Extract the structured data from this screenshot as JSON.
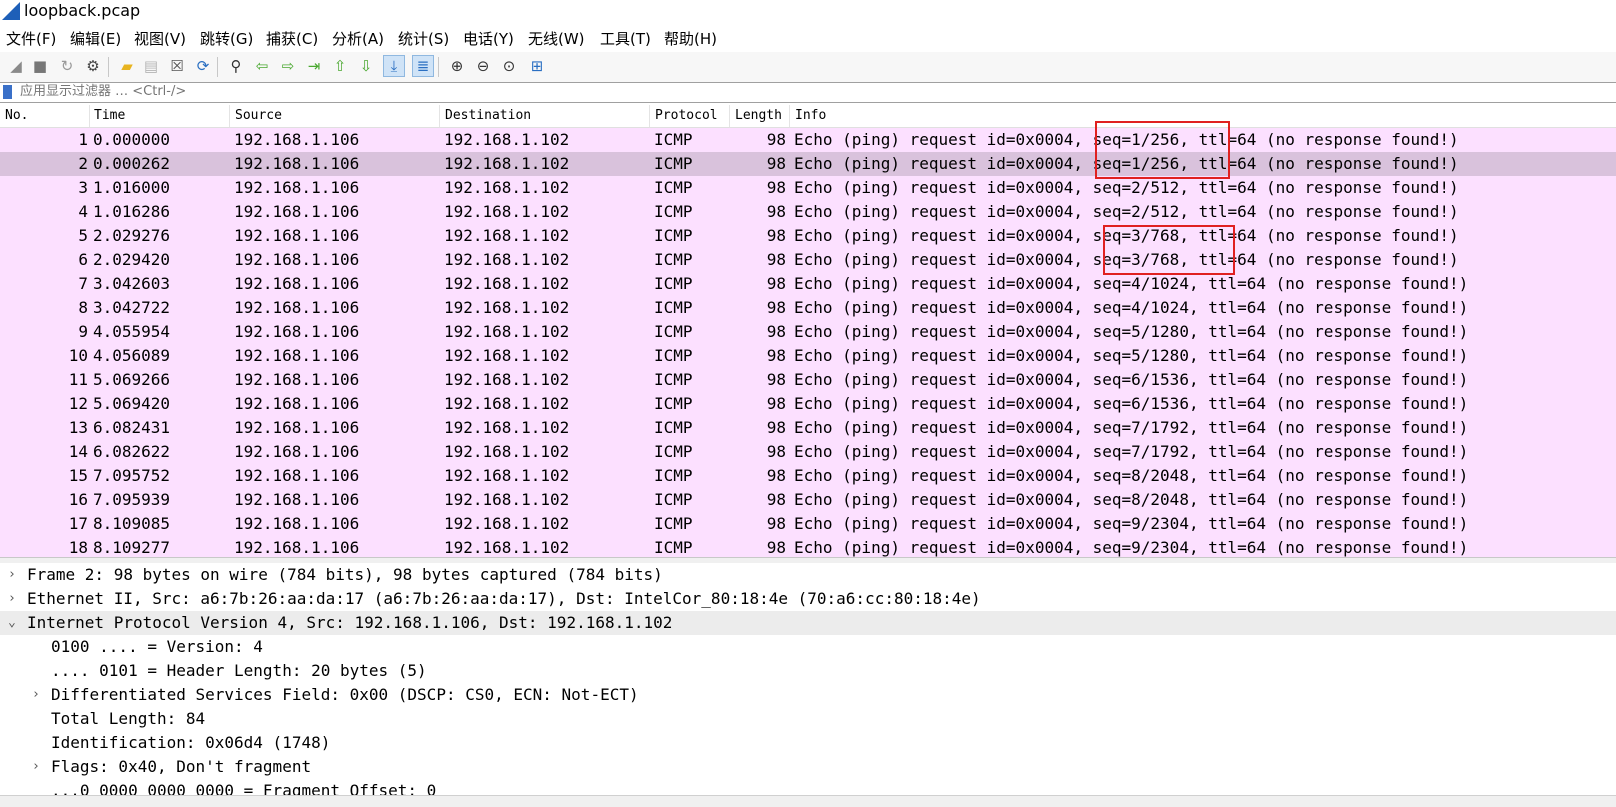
{
  "window": {
    "title": "loopback.pcap"
  },
  "menu": [
    "文件(F)",
    "编辑(E)",
    "视图(V)",
    "跳转(G)",
    "捕获(C)",
    "分析(A)",
    "统计(S)",
    "电话(Y)",
    "无线(W)",
    "工具(T)",
    "帮助(H)"
  ],
  "toolbar": {
    "icons": [
      "start-capture-icon",
      "stop-capture-icon",
      "restart-capture-icon",
      "capture-options-icon",
      "open-file-icon",
      "save-file-icon",
      "close-file-icon",
      "reload-file-icon",
      "find-packet-icon",
      "go-back-icon",
      "go-forward-icon",
      "go-to-packet-icon",
      "go-first-icon",
      "go-last-icon",
      "autoscroll-icon",
      "colorize-icon",
      "zoom-in-icon",
      "zoom-out-icon",
      "zoom-normal-icon",
      "resize-columns-icon"
    ]
  },
  "filter": {
    "placeholder": "应用显示过滤器 … <Ctrl-/>"
  },
  "columns": {
    "no": "No.",
    "time": "Time",
    "source": "Source",
    "destination": "Destination",
    "protocol": "Protocol",
    "length": "Length",
    "info": "Info"
  },
  "packets": [
    {
      "no": "1",
      "time": "0.000000",
      "src": "192.168.1.106",
      "dst": "192.168.1.102",
      "proto": "ICMP",
      "len": "98",
      "info": "Echo (ping) request  id=0x0004, seq=1/256, ttl=64 (no response found!)"
    },
    {
      "no": "2",
      "time": "0.000262",
      "src": "192.168.1.106",
      "dst": "192.168.1.102",
      "proto": "ICMP",
      "len": "98",
      "info": "Echo (ping) request  id=0x0004, seq=1/256, ttl=64 (no response found!)"
    },
    {
      "no": "3",
      "time": "1.016000",
      "src": "192.168.1.106",
      "dst": "192.168.1.102",
      "proto": "ICMP",
      "len": "98",
      "info": "Echo (ping) request  id=0x0004, seq=2/512, ttl=64 (no response found!)"
    },
    {
      "no": "4",
      "time": "1.016286",
      "src": "192.168.1.106",
      "dst": "192.168.1.102",
      "proto": "ICMP",
      "len": "98",
      "info": "Echo (ping) request  id=0x0004, seq=2/512, ttl=64 (no response found!)"
    },
    {
      "no": "5",
      "time": "2.029276",
      "src": "192.168.1.106",
      "dst": "192.168.1.102",
      "proto": "ICMP",
      "len": "98",
      "info": "Echo (ping) request  id=0x0004, seq=3/768, ttl=64 (no response found!)"
    },
    {
      "no": "6",
      "time": "2.029420",
      "src": "192.168.1.106",
      "dst": "192.168.1.102",
      "proto": "ICMP",
      "len": "98",
      "info": "Echo (ping) request  id=0x0004, seq=3/768, ttl=64 (no response found!)"
    },
    {
      "no": "7",
      "time": "3.042603",
      "src": "192.168.1.106",
      "dst": "192.168.1.102",
      "proto": "ICMP",
      "len": "98",
      "info": "Echo (ping) request  id=0x0004, seq=4/1024, ttl=64 (no response found!)"
    },
    {
      "no": "8",
      "time": "3.042722",
      "src": "192.168.1.106",
      "dst": "192.168.1.102",
      "proto": "ICMP",
      "len": "98",
      "info": "Echo (ping) request  id=0x0004, seq=4/1024, ttl=64 (no response found!)"
    },
    {
      "no": "9",
      "time": "4.055954",
      "src": "192.168.1.106",
      "dst": "192.168.1.102",
      "proto": "ICMP",
      "len": "98",
      "info": "Echo (ping) request  id=0x0004, seq=5/1280, ttl=64 (no response found!)"
    },
    {
      "no": "10",
      "time": "4.056089",
      "src": "192.168.1.106",
      "dst": "192.168.1.102",
      "proto": "ICMP",
      "len": "98",
      "info": "Echo (ping) request  id=0x0004, seq=5/1280, ttl=64 (no response found!)"
    },
    {
      "no": "11",
      "time": "5.069266",
      "src": "192.168.1.106",
      "dst": "192.168.1.102",
      "proto": "ICMP",
      "len": "98",
      "info": "Echo (ping) request  id=0x0004, seq=6/1536, ttl=64 (no response found!)"
    },
    {
      "no": "12",
      "time": "5.069420",
      "src": "192.168.1.106",
      "dst": "192.168.1.102",
      "proto": "ICMP",
      "len": "98",
      "info": "Echo (ping) request  id=0x0004, seq=6/1536, ttl=64 (no response found!)"
    },
    {
      "no": "13",
      "time": "6.082431",
      "src": "192.168.1.106",
      "dst": "192.168.1.102",
      "proto": "ICMP",
      "len": "98",
      "info": "Echo (ping) request  id=0x0004, seq=7/1792, ttl=64 (no response found!)"
    },
    {
      "no": "14",
      "time": "6.082622",
      "src": "192.168.1.106",
      "dst": "192.168.1.102",
      "proto": "ICMP",
      "len": "98",
      "info": "Echo (ping) request  id=0x0004, seq=7/1792, ttl=64 (no response found!)"
    },
    {
      "no": "15",
      "time": "7.095752",
      "src": "192.168.1.106",
      "dst": "192.168.1.102",
      "proto": "ICMP",
      "len": "98",
      "info": "Echo (ping) request  id=0x0004, seq=8/2048, ttl=64 (no response found!)"
    },
    {
      "no": "16",
      "time": "7.095939",
      "src": "192.168.1.106",
      "dst": "192.168.1.102",
      "proto": "ICMP",
      "len": "98",
      "info": "Echo (ping) request  id=0x0004, seq=8/2048, ttl=64 (no response found!)"
    },
    {
      "no": "17",
      "time": "8.109085",
      "src": "192.168.1.106",
      "dst": "192.168.1.102",
      "proto": "ICMP",
      "len": "98",
      "info": "Echo (ping) request  id=0x0004, seq=9/2304, ttl=64 (no response found!)"
    },
    {
      "no": "18",
      "time": "8.109277",
      "src": "192.168.1.106",
      "dst": "192.168.1.102",
      "proto": "ICMP",
      "len": "98",
      "info": "Echo (ping) request  id=0x0004, seq=9/2304, ttl=64 (no response found!)"
    }
  ],
  "selected_packet": "2",
  "details": [
    {
      "arrow": "›",
      "text": "Frame 2: 98 bytes on wire (784 bits), 98 bytes captured (784 bits)"
    },
    {
      "arrow": "›",
      "text": "Ethernet II, Src: a6:7b:26:aa:da:17 (a6:7b:26:aa:da:17), Dst: IntelCor_80:18:4e (70:a6:cc:80:18:4e)"
    },
    {
      "arrow": "⌄",
      "text": "Internet Protocol Version 4, Src: 192.168.1.106, Dst: 192.168.1.102"
    },
    {
      "arrow": "",
      "text": "0100 .... = Version: 4"
    },
    {
      "arrow": "",
      "text": ".... 0101 = Header Length: 20 bytes (5)"
    },
    {
      "arrow": "›",
      "text": "Differentiated Services Field: 0x00 (DSCP: CS0, ECN: Not-ECT)"
    },
    {
      "arrow": "",
      "text": "Total Length: 84"
    },
    {
      "arrow": "",
      "text": "Identification: 0x06d4 (1748)"
    },
    {
      "arrow": "›",
      "text": "Flags: 0x40, Don't fragment"
    },
    {
      "arrow": "",
      "text": "...0 0000 0000 0000 = Fragment Offset: 0"
    }
  ],
  "colors": {
    "icmp_row": "#fce0ff",
    "selected_row": "#d9c2dc",
    "annotation": "#e02020"
  }
}
